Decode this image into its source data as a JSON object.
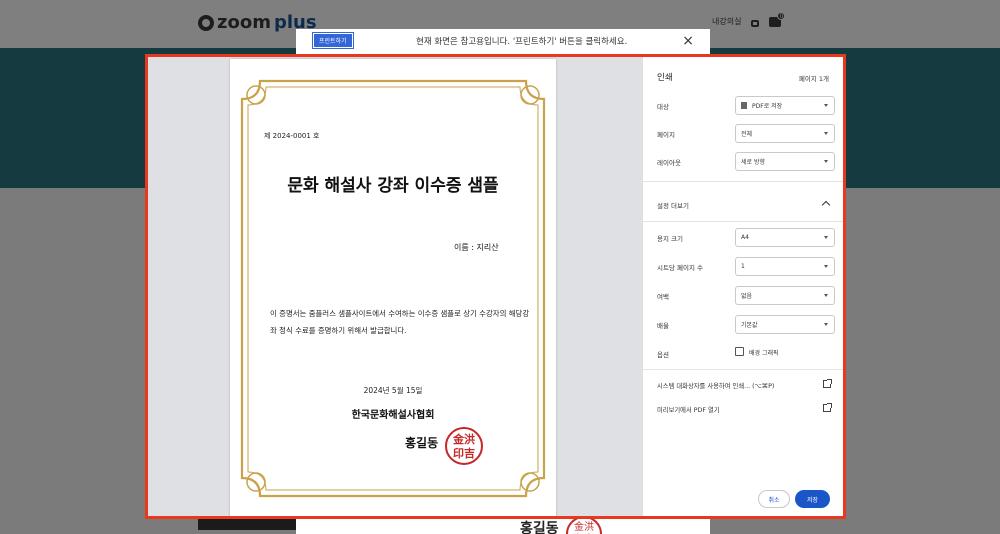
{
  "site": {
    "logo_text": "zoom",
    "logo_plus": "plus",
    "nav_text": "내강의실",
    "cart_count": "0"
  },
  "notice": {
    "print_button": "프린트하기",
    "message": "현재 화면은 참고용입니다. '프린트하기' 버튼을 클릭하세요.",
    "close": "×"
  },
  "certificate": {
    "number": "제 2024-0001 호",
    "title": "문화 해설사 강좌 이수증 샘플",
    "name": "이름 : 지리산",
    "text": "이 증명서는 줌플러스 샘플사이트에서 수여하는 이수증 샘플로 상기 수강자의 해당강좌 정식 수료를 증명하기 위해서 발급합니다.",
    "date": "2024년 5월 15일",
    "org": "한국문화해설사협회",
    "signer": "홍길동",
    "seal": "金洪\n印吉",
    "frame_color": "#c9a24a"
  },
  "print_panel": {
    "title": "인쇄",
    "pages_count": "페이지 1개",
    "destination_label": "대상",
    "destination_value": "PDF로 저장",
    "pages_label": "페이지",
    "pages_value": "전체",
    "layout_label": "레이아웃",
    "layout_value": "세로 방향",
    "more_settings": "설정 더보기",
    "paper_size_label": "용지 크기",
    "paper_size_value": "A4",
    "pages_per_sheet_label": "시트당 페이지 수",
    "pages_per_sheet_value": "1",
    "margins_label": "여백",
    "margins_value": "없음",
    "scale_label": "배율",
    "scale_value": "기본값",
    "options_label": "옵션",
    "background_graphics": "배경 그래픽",
    "system_dialog": "시스템 대화상자를 사용하여 인쇄... (⌥⌘P)",
    "open_pdf_preview": "미리보기에서 PDF 열기",
    "cancel": "취소",
    "save": "저장"
  },
  "popup_bottom": {
    "signer": "홍길동",
    "seal": "金洪\n印吉"
  },
  "colors": {
    "dialog_border": "#e8391f",
    "accent": "#1a56c8",
    "seal_red": "#c62828"
  }
}
